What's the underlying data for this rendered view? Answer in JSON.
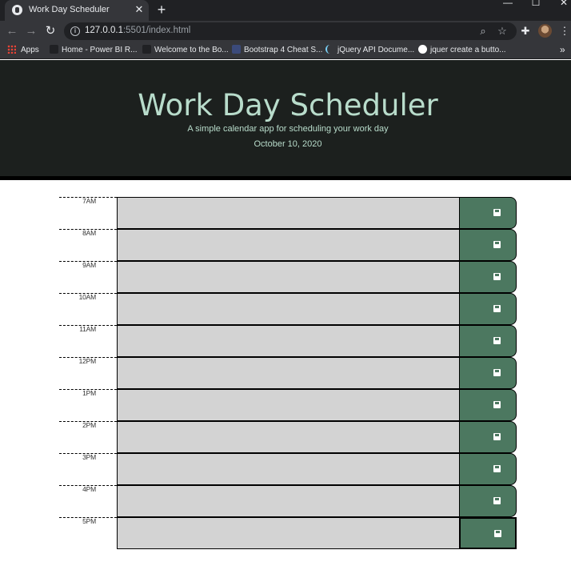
{
  "browser": {
    "tab_title": "Work Day Scheduler",
    "tab_close": "✕",
    "new_tab": "+",
    "url_host": "127.0.0.1",
    "url_rest": ":5501/index.html",
    "bookmarks": [
      {
        "label": "Apps",
        "icon": "apps-grid-icon"
      },
      {
        "label": "Home - Power BI R...",
        "icon": "powerbi-icon"
      },
      {
        "label": "Welcome to the Bo...",
        "icon": "bookmark-icon"
      },
      {
        "label": "Bootstrap 4 Cheat S...",
        "icon": "h-icon"
      },
      {
        "label": "jQuery API Docume...",
        "icon": "jquery-icon"
      },
      {
        "label": "jquer create a butto...",
        "icon": "google-icon"
      }
    ],
    "bookmarks_more": "»"
  },
  "header": {
    "title": "Work Day Scheduler",
    "subtitle": "A simple calendar app for scheduling your work day",
    "current_day": "October 10, 2020"
  },
  "schedule": {
    "hours": [
      "7AM",
      "8AM",
      "9AM",
      "10AM",
      "11AM",
      "12PM",
      "1PM",
      "2PM",
      "3PM",
      "4PM",
      "5PM"
    ],
    "save_icon": "floppy-disk-icon"
  },
  "colors": {
    "header_bg": "#1c201e",
    "header_text": "#b8dccb",
    "save_button": "#4c7860",
    "textarea": "#d3d3d3"
  }
}
